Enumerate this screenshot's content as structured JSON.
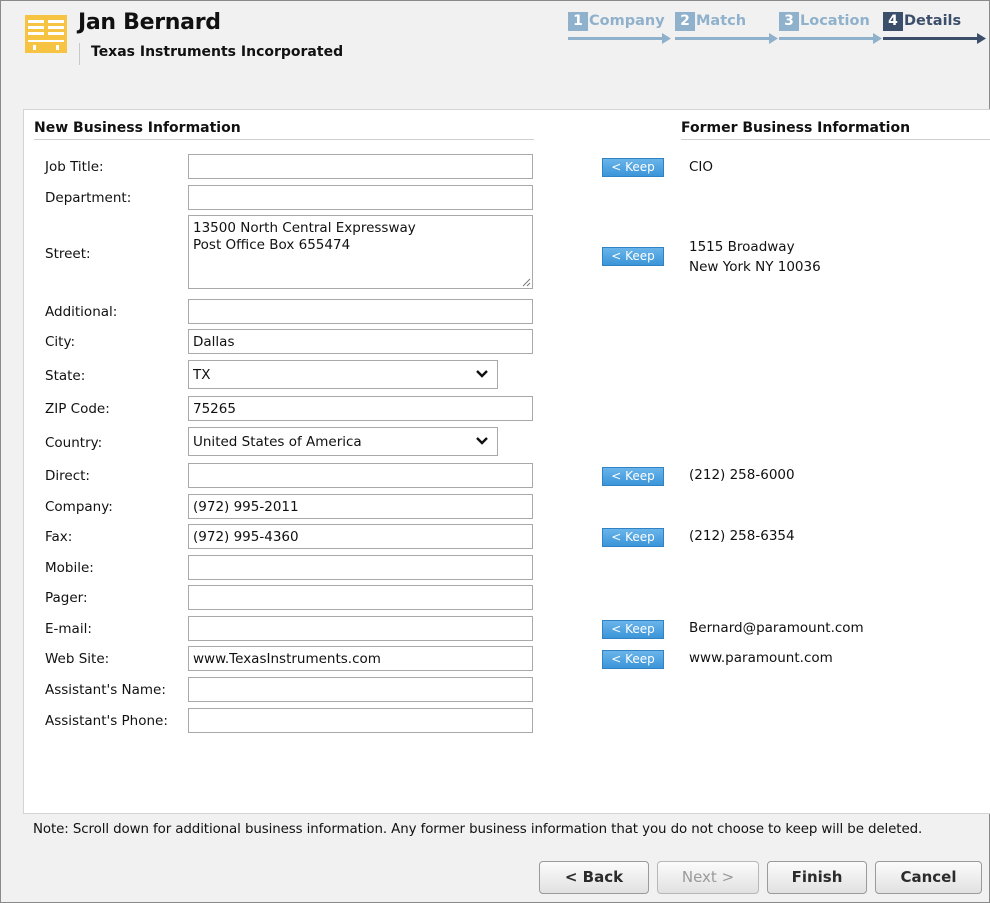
{
  "header": {
    "name": "Jan Bernard",
    "company": "Texas Instruments Incorporated"
  },
  "steps": [
    {
      "num": "1",
      "label": "Company",
      "state": "done"
    },
    {
      "num": "2",
      "label": "Match",
      "state": "done"
    },
    {
      "num": "3",
      "label": "Location",
      "state": "done"
    },
    {
      "num": "4",
      "label": "Details",
      "state": "current"
    }
  ],
  "sections": {
    "new_title": "New Business Information",
    "former_title": "Former Business Information"
  },
  "keep_label": "< Keep",
  "fields": {
    "job_title": {
      "label": "Job Title:",
      "value": ""
    },
    "department": {
      "label": "Department:",
      "value": ""
    },
    "street": {
      "label": "Street:",
      "value": "13500 North Central Expressway\nPost Office Box 655474"
    },
    "additional": {
      "label": "Additional:",
      "value": ""
    },
    "city": {
      "label": "City:",
      "value": "Dallas"
    },
    "state": {
      "label": "State:",
      "value": "TX"
    },
    "zip": {
      "label": "ZIP Code:",
      "value": "75265"
    },
    "country": {
      "label": "Country:",
      "value": "United States of America"
    },
    "direct": {
      "label": "Direct:",
      "value": ""
    },
    "company_phone": {
      "label": "Company:",
      "value": "(972) 995-2011"
    },
    "fax": {
      "label": "Fax:",
      "value": "(972) 995-4360"
    },
    "mobile": {
      "label": "Mobile:",
      "value": ""
    },
    "pager": {
      "label": "Pager:",
      "value": ""
    },
    "email": {
      "label": "E-mail:",
      "value": ""
    },
    "website": {
      "label": "Web Site:",
      "value": "www.TexasInstruments.com"
    },
    "assistant_name": {
      "label": "Assistant's Name:",
      "value": ""
    },
    "assistant_phone": {
      "label": "Assistant's Phone:",
      "value": ""
    }
  },
  "former": {
    "job_title": "CIO",
    "street_line1": "1515 Broadway",
    "street_line2": "New York NY 10036",
    "direct": "(212) 258-6000",
    "fax": "(212) 258-6354",
    "email": "Bernard@paramount.com",
    "website": "www.paramount.com"
  },
  "note": "Note: Scroll down for additional business information. Any former business information that you do not choose to keep will be deleted.",
  "buttons": {
    "back": "< Back",
    "next": "Next >",
    "finish": "Finish",
    "cancel": "Cancel"
  },
  "colors": {
    "step_done": "#8fb1cc",
    "step_current": "#3b4f6b",
    "keep_button": "#3b95d8"
  }
}
